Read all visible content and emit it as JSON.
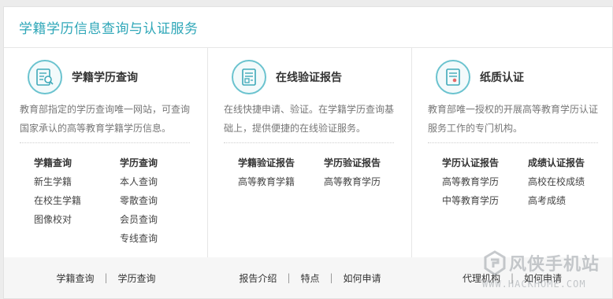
{
  "header": {
    "title": "学籍学历信息查询与认证服务"
  },
  "columns": [
    {
      "icon": "id-card-search-icon",
      "title": "学籍学历查询",
      "desc": [
        "教育部指定的学历查询唯一网站，可查询",
        "国家承认的高等教育学籍学历信息。"
      ],
      "groups": [
        {
          "head": "学籍查询",
          "items": [
            "新生学籍",
            "在校生学籍",
            "图像校对"
          ]
        },
        {
          "head": "学历查询",
          "items": [
            "本人查询",
            "零散查询",
            "会员查询",
            "专线查询"
          ]
        }
      ]
    },
    {
      "icon": "verification-report-icon",
      "title": "在线验证报告",
      "desc": [
        "在线快捷申请、验证。在学籍学历查询基",
        "础上，提供便捷的在线验证服务。"
      ],
      "groups": [
        {
          "head": "学籍验证报告",
          "items": [
            "高等教育学籍"
          ]
        },
        {
          "head": "学历验证报告",
          "items": [
            "高等教育学历"
          ]
        }
      ]
    },
    {
      "icon": "paper-certificate-icon",
      "title": "纸质认证",
      "desc": [
        "教育部唯一授权的开展高等教育学历认证",
        "服务工作的专门机构。"
      ],
      "groups": [
        {
          "head": "学历认证报告",
          "items": [
            "高等教育学历",
            "中等教育学历"
          ]
        },
        {
          "head": "成绩认证报告",
          "items": [
            "高校在校成绩",
            "高考成绩"
          ]
        }
      ]
    }
  ],
  "footer": [
    [
      "学籍查询",
      "学历查询"
    ],
    [
      "报告介绍",
      "特点",
      "如何申请"
    ],
    [
      "代理机构",
      "如何申请"
    ]
  ],
  "footer_separator": "|",
  "watermark": {
    "name": "风侠手机站",
    "url": "WWW.HACKHOME.COM"
  },
  "colors": {
    "accent": "#2fa7b8",
    "icon_ring": "#6bc3cf",
    "footer_bg": "#f6f6f6"
  }
}
